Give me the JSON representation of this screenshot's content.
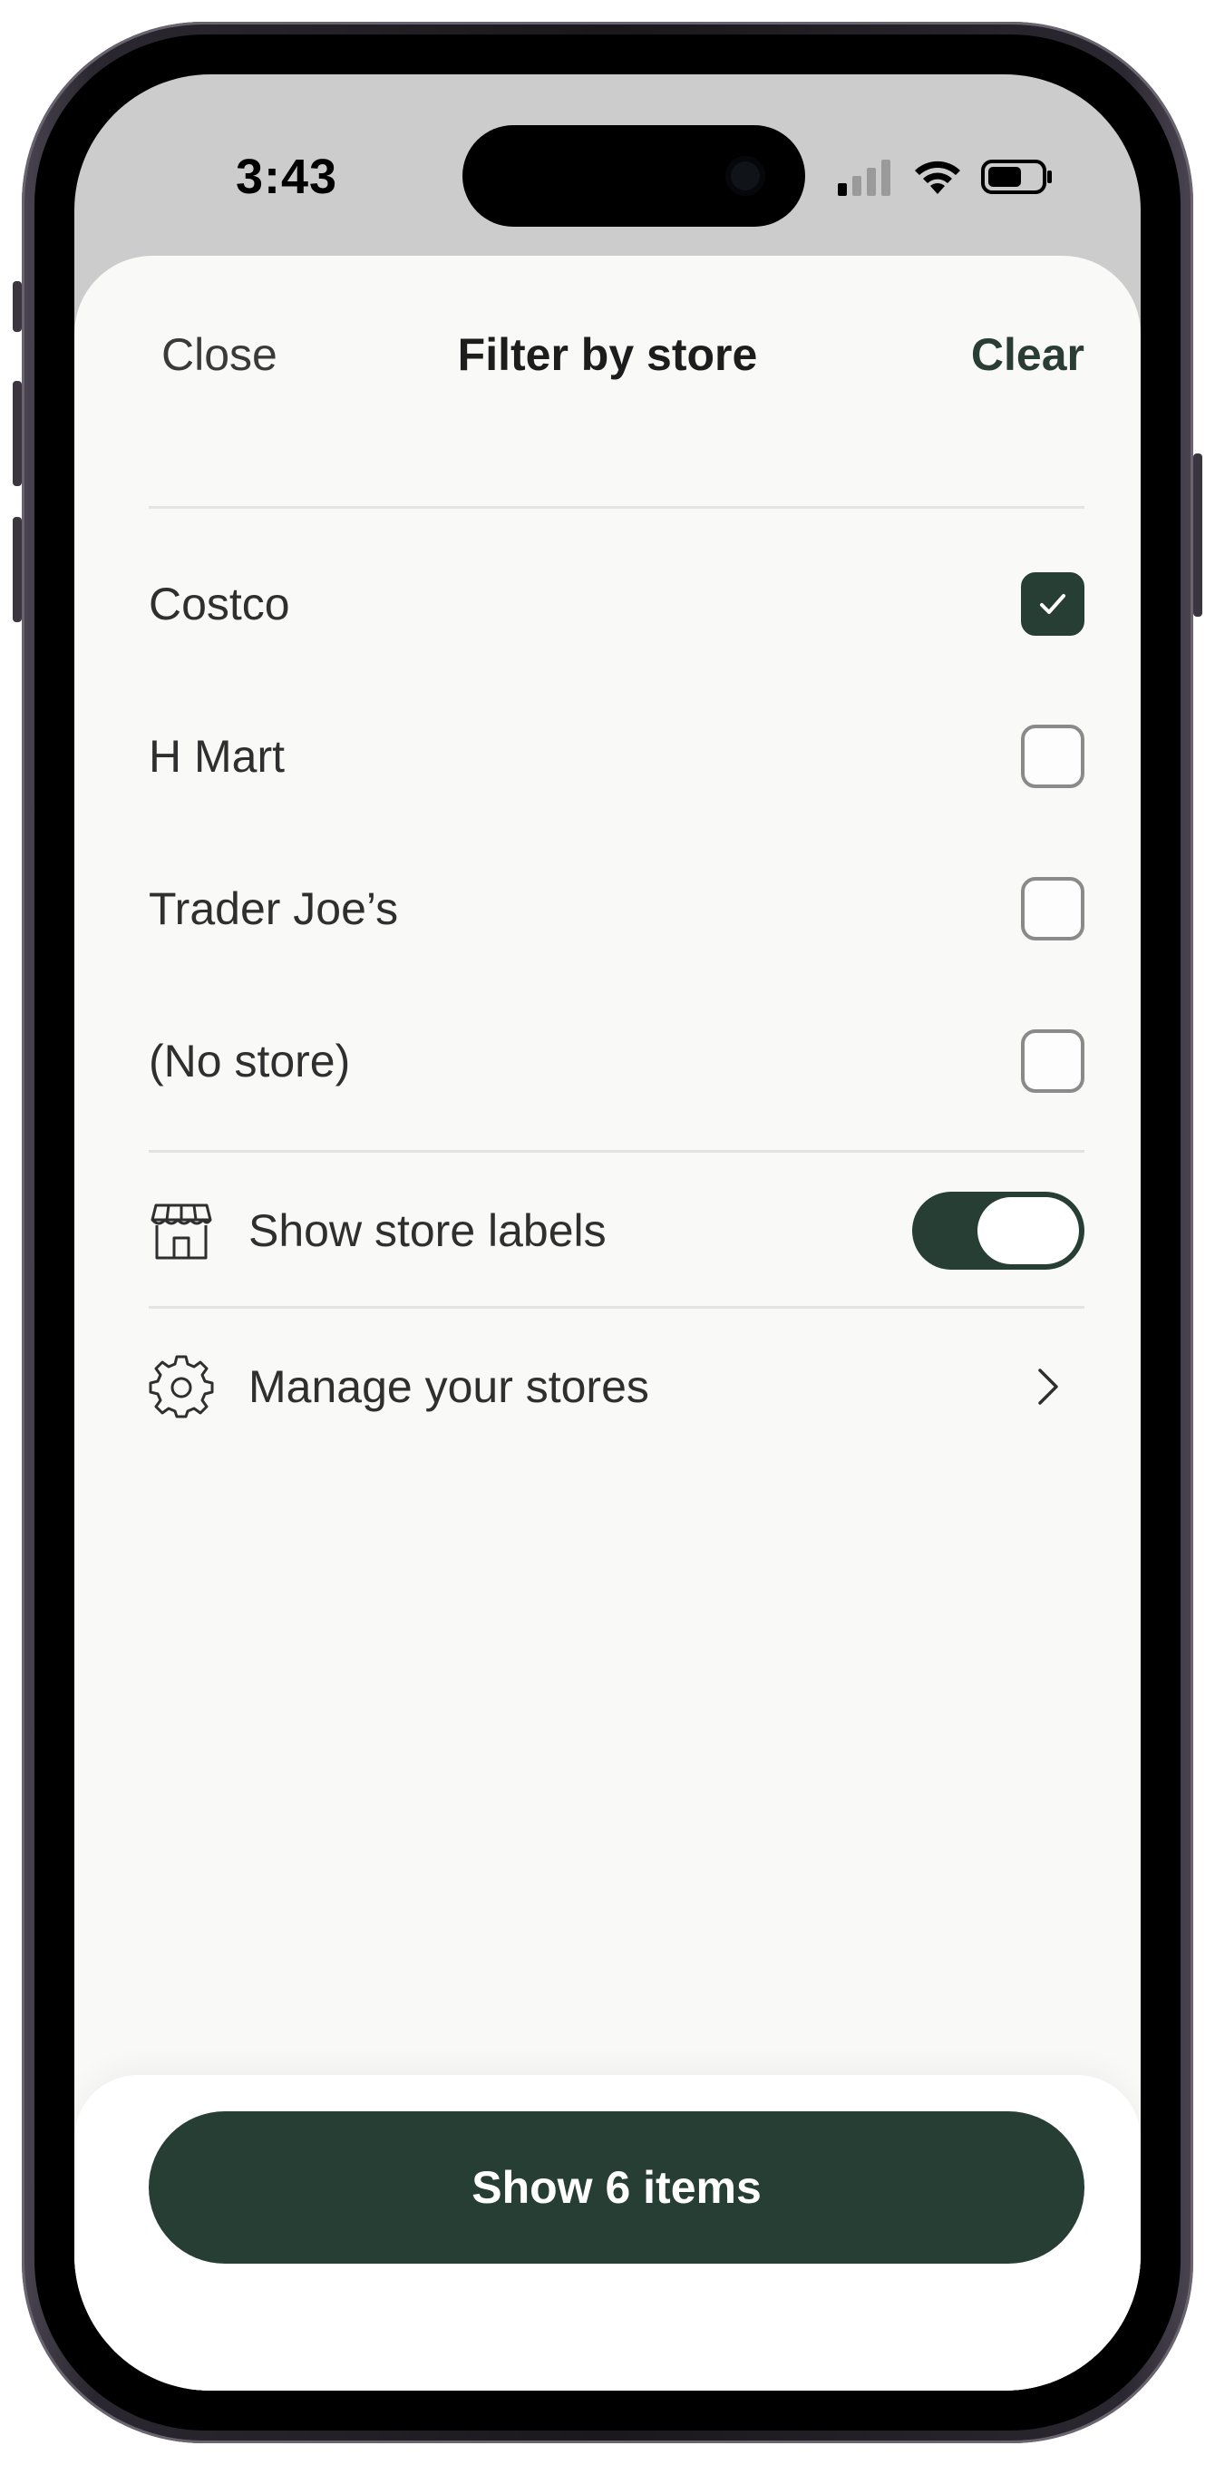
{
  "status_bar": {
    "time": "3:43",
    "icons": [
      "cellular-signal-icon",
      "wifi-icon",
      "battery-icon"
    ]
  },
  "header": {
    "close_label": "Close",
    "title": "Filter by store",
    "clear_label": "Clear"
  },
  "stores": [
    {
      "label": "Costco",
      "checked": true
    },
    {
      "label": "H Mart",
      "checked": false
    },
    {
      "label": "Trader Joe’s",
      "checked": false
    },
    {
      "label": "(No store)",
      "checked": false
    }
  ],
  "settings": {
    "store_labels": {
      "label": "Show store labels",
      "icon": "storefront-icon",
      "enabled": true
    },
    "manage": {
      "label": "Manage your stores",
      "icon": "gear-icon"
    }
  },
  "footer": {
    "button_label": "Show 6 items"
  },
  "colors": {
    "accent": "#263e33",
    "sheet_background": "#f9f9f8",
    "text": "#2f2f2f"
  }
}
